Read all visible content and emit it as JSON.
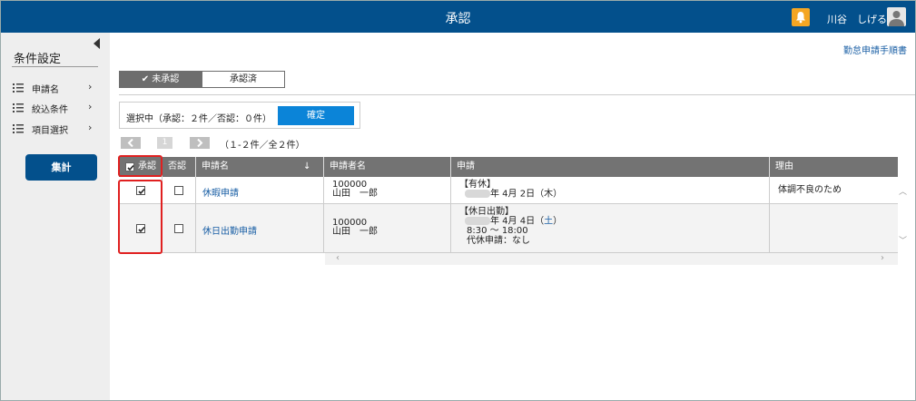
{
  "header": {
    "title": "承認",
    "user_name": "川谷　しげる"
  },
  "sidebar": {
    "title": "条件設定",
    "items": [
      {
        "label": "申請名",
        "chevron": "›"
      },
      {
        "label": "絞込条件",
        "chevron": "›"
      },
      {
        "label": "項目選択",
        "chevron": "›"
      }
    ],
    "sum_button": "集計"
  },
  "manual_link": "勤怠申請手順書",
  "tabs": [
    {
      "label": "未承認",
      "active": true,
      "check": "✔"
    },
    {
      "label": "承認済",
      "active": false
    }
  ],
  "selection": {
    "text": "選択中（承認：２件／否認：０件）",
    "confirm_label": "確定"
  },
  "pager": {
    "page": "1",
    "info": "（１-２件／全２件）"
  },
  "table": {
    "columns": [
      "承認",
      "否認",
      "申請名",
      "申請者名",
      "申請",
      "理由"
    ],
    "sort_icon": "↓",
    "rows": [
      {
        "approve": true,
        "reject": false,
        "app_name": "休暇申請",
        "applicant_id": "100000",
        "applicant_name": "山田　一郎",
        "request_type": "【有休】",
        "request_date": "年 4月 2日（木）",
        "reason": "体調不良のため"
      },
      {
        "approve": true,
        "reject": false,
        "app_name": "休日出勤申請",
        "applicant_id": "100000",
        "applicant_name": "山田　一郎",
        "request_type": "【休日出勤】",
        "request_date_prefix": "年 4月 4日（",
        "request_date_day": "土",
        "request_date_suffix": "）",
        "request_time": "8:30 ～ 18:00",
        "request_extra": "代休申請：なし",
        "reason": ""
      }
    ]
  },
  "colors": {
    "primary": "#03508c",
    "accent": "#0b84d8",
    "bell": "#f5a623",
    "highlight": "#e02020"
  }
}
